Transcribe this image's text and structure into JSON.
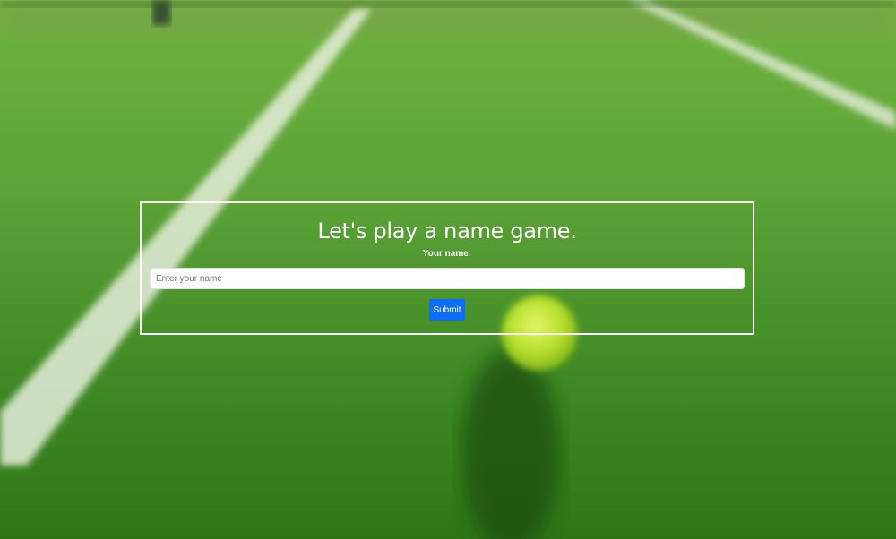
{
  "page": {
    "background_image": "blurred-tennis-court-grass-with-ball",
    "colors": {
      "grass": "#4a8f2a",
      "line": "#e8efe0",
      "ball": "#b5e02a",
      "button": "#0d6efd",
      "box_border": "#ffffff"
    }
  },
  "form": {
    "title": "Let's play a name game.",
    "name_label": "Your name:",
    "name_placeholder": "Enter your name",
    "name_value": "",
    "submit_label": "Submit"
  }
}
